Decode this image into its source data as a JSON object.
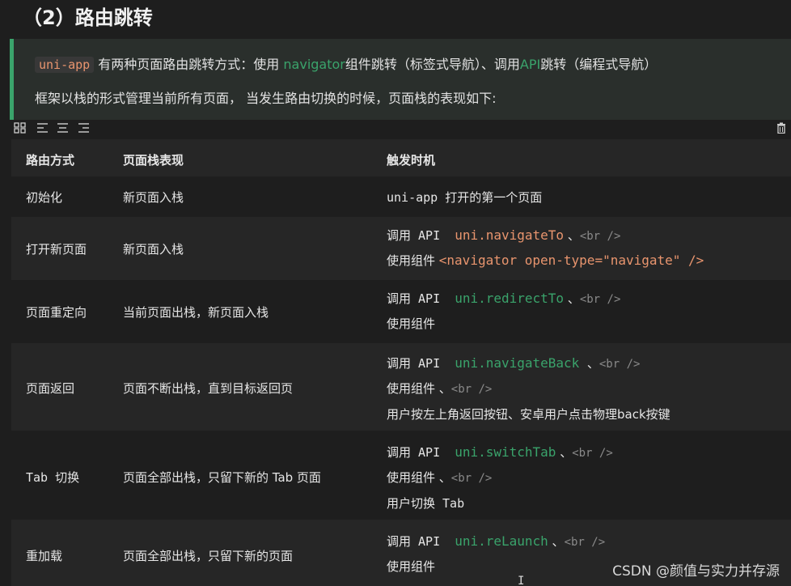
{
  "heading": "（2）路由跳转",
  "quote": {
    "line1_code": "uni-app",
    "line1_text_a": " 有两种页面路由跳转方式：使用 ",
    "line1_navigator": "navigator",
    "line1_text_b": "组件跳转（标签式导航）、调用",
    "line1_api": "API",
    "line1_text_c": "跳转（编程式导航）",
    "line2": "框架以栈的形式管理当前所有页面， 当发生路由切换的时候，页面栈的表现如下:"
  },
  "toolbar": {
    "icons": [
      "grid-icon",
      "align-left-icon",
      "align-center-icon",
      "align-right-icon",
      "trash-icon"
    ]
  },
  "table": {
    "headers": [
      "路由方式",
      "页面栈表现",
      "触发时机"
    ],
    "rows": [
      {
        "route": "初始化",
        "stack": "新页面入栈",
        "trigger": [
          "uni-app 打开的第一个页面"
        ]
      },
      {
        "route": "打开新页面",
        "stack": "新页面入栈",
        "t1_prefix": "调用 API  ",
        "t1_code": "uni.navigateTo",
        "t1_sep": " 、",
        "t1_br": "<br />",
        "t2_prefix": "使用组件 ",
        "t2_code": "<navigator open-type=\"navigate\" />"
      },
      {
        "route": "页面重定向",
        "stack": "当前页面出栈，新页面入栈",
        "t1_prefix": "调用 API  ",
        "t1_code": "uni.redirectTo",
        "t1_sep": " 、",
        "t1_br": "<br />",
        "t2_prefix": "使用组件"
      },
      {
        "route": "页面返回",
        "stack": "页面不断出栈，直到目标返回页",
        "t1_prefix": "调用 API  ",
        "t1_code": "uni.navigateBack",
        "t1_sep": "  、",
        "t1_br": "<br />",
        "t2_prefix": "使用组件 、",
        "t2_br": "<br />",
        "t3": "用户按左上角返回按钮、安卓用户点击物理back按键"
      },
      {
        "route": "Tab 切换",
        "stack": "页面全部出栈，只留下新的 Tab 页面",
        "t1_prefix": "调用 API  ",
        "t1_code": "uni.switchTab",
        "t1_sep": " 、",
        "t1_br": "<br />",
        "t2_prefix": "使用组件 、",
        "t2_br": "<br />",
        "t3": "用户切换 Tab"
      },
      {
        "route": "重加载",
        "stack": "页面全部出栈，只留下新的页面",
        "t1_prefix": "调用 API  ",
        "t1_code": "uni.reLaunch",
        "t1_sep": " 、",
        "t1_br": "<br />",
        "t2_prefix": "使用组件"
      }
    ]
  },
  "watermark": "CSDN @颜值与实力并存源",
  "cursor": "I"
}
